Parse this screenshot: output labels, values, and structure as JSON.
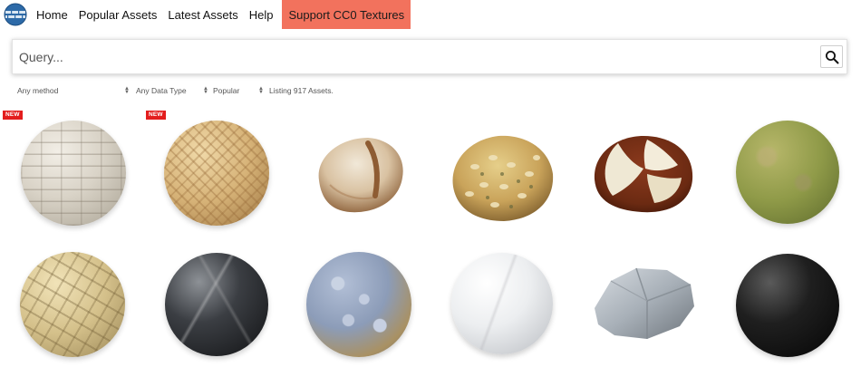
{
  "nav": {
    "logo": "globe-logo",
    "items": [
      "Home",
      "Popular Assets",
      "Latest Assets",
      "Help"
    ],
    "support": "Support CC0 Textures",
    "support_color": "#f2725d"
  },
  "search": {
    "placeholder": "Query...",
    "icon": "search-icon"
  },
  "filters": {
    "method": "Any method",
    "data_type": "Any Data Type",
    "sort": "Popular",
    "listing": "Listing 917 Assets."
  },
  "badge_color": "#e31d1d",
  "assets": [
    {
      "badge": "NEW",
      "kind": "brick-wall-sphere"
    },
    {
      "badge": "NEW",
      "kind": "herringbone-wood-sphere"
    },
    {
      "badge": "",
      "kind": "bread-loaf"
    },
    {
      "badge": "",
      "kind": "seeded-bread-roll"
    },
    {
      "badge": "",
      "kind": "pretzel-roll"
    },
    {
      "badge": "",
      "kind": "mossy-ground-sphere"
    },
    {
      "badge": "",
      "kind": "paving-stones-sphere"
    },
    {
      "badge": "",
      "kind": "dark-marble-sphere"
    },
    {
      "badge": "",
      "kind": "pebbles-sphere"
    },
    {
      "badge": "",
      "kind": "white-marble-sphere"
    },
    {
      "badge": "",
      "kind": "rock"
    },
    {
      "badge": "",
      "kind": "black-leather-sphere"
    }
  ]
}
